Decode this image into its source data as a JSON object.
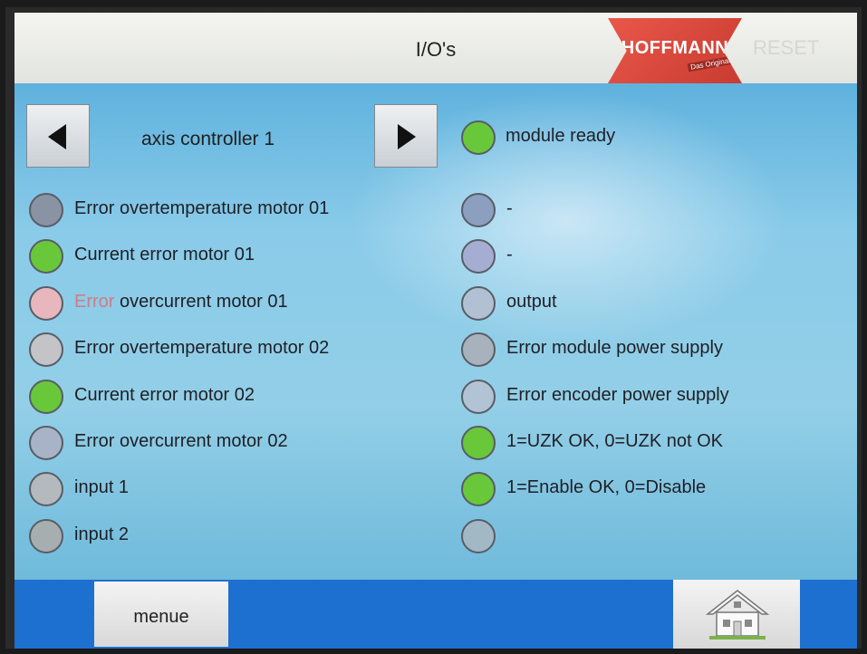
{
  "header": {
    "title": "I/O's",
    "logo_text": "HOFFMANN",
    "logo_tagline": "Das Original",
    "reset_label": "RESET"
  },
  "controller": {
    "label": "axis controller 1",
    "prev_icon": "arrow-left-icon",
    "next_icon": "arrow-right-icon"
  },
  "status": {
    "module_ready": {
      "label": "module ready",
      "state": "on"
    }
  },
  "left_column": [
    {
      "prefix": "",
      "label": "Error overtemperature motor 01",
      "state": "off"
    },
    {
      "prefix": "",
      "label": "Current error motor 01",
      "state": "on"
    },
    {
      "prefix": "Error",
      "label": " overcurrent motor 01",
      "state": "off"
    },
    {
      "prefix": "",
      "label": "Error overtemperature motor 02",
      "state": "off"
    },
    {
      "prefix": "",
      "label": "Current error motor 02",
      "state": "on"
    },
    {
      "prefix": "",
      "label": "Error overcurrent motor 02",
      "state": "off"
    },
    {
      "prefix": "",
      "label": "input 1",
      "state": "off"
    },
    {
      "prefix": "",
      "label": "input 2",
      "state": "off"
    }
  ],
  "right_column": [
    {
      "label": "-",
      "state": "off"
    },
    {
      "label": "-",
      "state": "off"
    },
    {
      "label": "output",
      "state": "off"
    },
    {
      "label": "Error module power supply",
      "state": "off"
    },
    {
      "label": "Error encoder power supply",
      "state": "off"
    },
    {
      "label": "1=UZK OK, 0=UZK not OK",
      "state": "on"
    },
    {
      "label": "1=Enable OK, 0=Disable",
      "state": "on"
    },
    {
      "label": "",
      "state": "off"
    }
  ],
  "footer": {
    "menu_label": "menue",
    "home_icon": "home-icon"
  },
  "colors": {
    "led_on": "#68c83a",
    "led_off_left": [
      "#8a93a4",
      "#68c83a",
      "#e8b7bd",
      "#c3c3c8",
      "#68c83a",
      "#a8b3c8",
      "#b4b9be",
      "#a6aeb0"
    ],
    "led_off_right": [
      "#8d9fbf",
      "#a5aed2",
      "#b1c0d2",
      "#a8b2bd",
      "#b3c3d6",
      "#68c83a",
      "#68c83a",
      "#a3b8c5"
    ],
    "footer_blue": "#1d6fd0",
    "panel_blue": "#8acbe9"
  }
}
